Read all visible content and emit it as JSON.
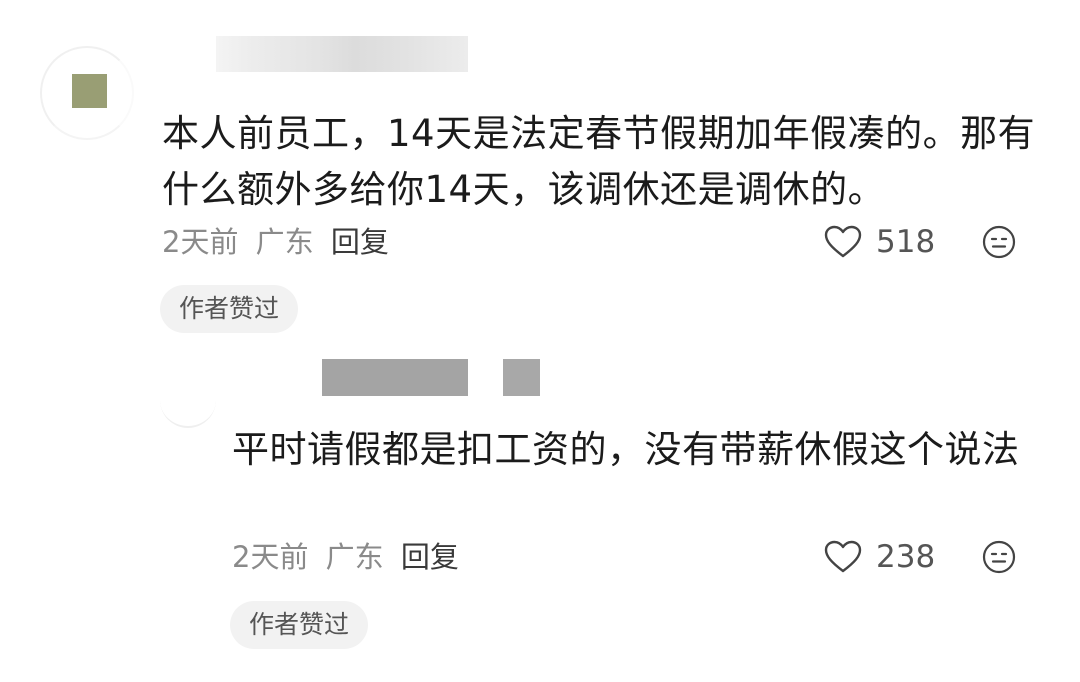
{
  "comments": [
    {
      "text": "本人前员工，14天是法定春节假期加年假凑的。那有什么额外多给你14天，该调休还是调休的。",
      "time": "2天前",
      "location": "广东",
      "reply_label": "回复",
      "likes": "518",
      "badge": "作者赞过",
      "avatar_color": "#999e74"
    },
    {
      "text": "平时请假都是扣工资的，没有带薪休假这个说法",
      "time": "2天前",
      "location": "广东",
      "reply_label": "回复",
      "likes": "238",
      "badge": "作者赞过"
    }
  ],
  "icons": {
    "like": "heart-outline-icon",
    "emoji": "emoji-face-icon"
  }
}
